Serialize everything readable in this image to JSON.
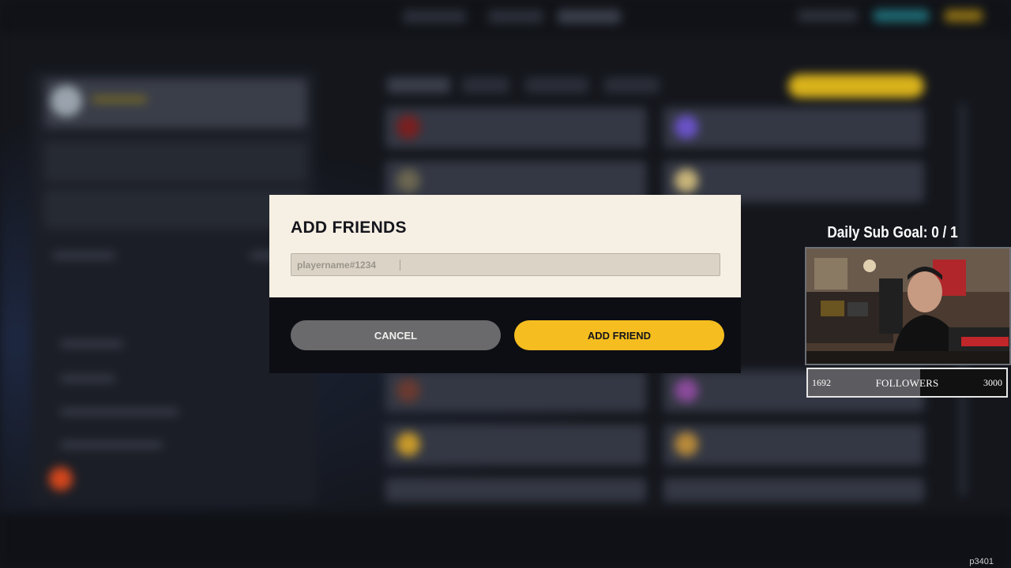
{
  "modal": {
    "title": "ADD FRIENDS",
    "input": {
      "placeholder": "playername#1234",
      "value": ""
    },
    "cancel_label": "CANCEL",
    "add_label": "ADD FRIEND"
  },
  "overlay": {
    "sub_goal_text": "Daily Sub Goal:  0 / 1",
    "followers": {
      "current": "1692",
      "label": "FOLLOWERS",
      "target": "3000",
      "progress": 0.564
    },
    "corner_tag": "p3401"
  },
  "colors": {
    "accent_yellow": "#f5bd1f",
    "modal_bg": "#f6efe3",
    "cancel_gray": "#6a6a6d"
  }
}
